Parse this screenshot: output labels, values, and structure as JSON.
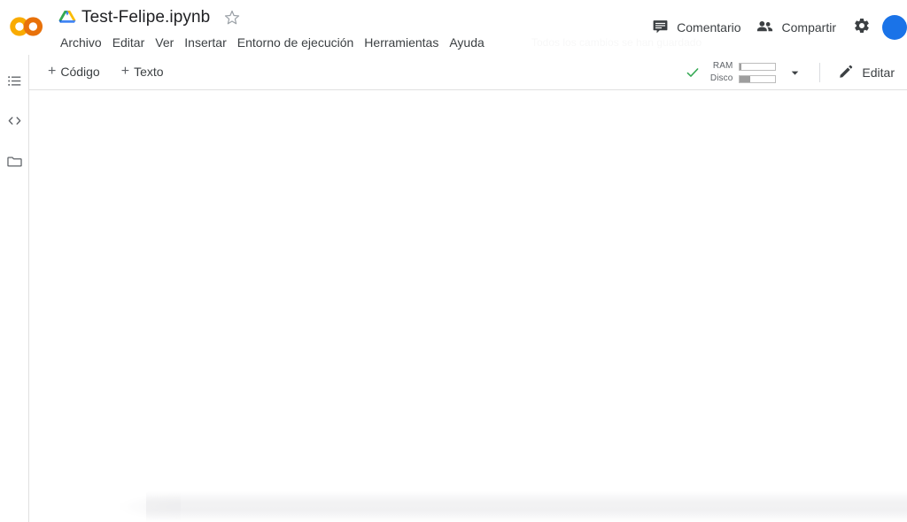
{
  "app": {
    "name": "Google Colab",
    "logo_icon": "colab-logo",
    "logo_colors": {
      "light": "#F9AB00",
      "dark": "#E8710A"
    }
  },
  "header": {
    "drive_icon": "google-drive-icon",
    "filename": "Test-Felipe.ipynb",
    "star_icon": "star-outline-icon",
    "save_status": "Todos los cambios se han guardado",
    "menu": [
      {
        "label": "Archivo",
        "name": "menu-archivo"
      },
      {
        "label": "Editar",
        "name": "menu-editar"
      },
      {
        "label": "Ver",
        "name": "menu-ver"
      },
      {
        "label": "Insertar",
        "name": "menu-insertar"
      },
      {
        "label": "Entorno de ejecución",
        "name": "menu-entorno-de-ejecucion"
      },
      {
        "label": "Herramientas",
        "name": "menu-herramientas"
      },
      {
        "label": "Ayuda",
        "name": "menu-ayuda"
      }
    ],
    "actions": {
      "comment_label": "Comentario",
      "comment_icon": "comment-icon",
      "share_label": "Compartir",
      "share_icon": "people-icon",
      "settings_icon": "gear-icon",
      "avatar": "user-avatar"
    }
  },
  "sidebar": {
    "items": [
      {
        "label": "Índice",
        "icon": "table-of-contents-icon",
        "name": "sidebar-item-toc"
      },
      {
        "label": "Fragmentos de código",
        "icon": "code-brackets-icon",
        "name": "sidebar-item-snippets"
      },
      {
        "label": "Archivos",
        "icon": "folder-icon",
        "name": "sidebar-item-files"
      }
    ]
  },
  "toolbar": {
    "add_code_label": "Código",
    "add_code_icon": "plus-icon",
    "add_text_label": "Texto",
    "add_text_icon": "plus-icon",
    "connection": {
      "status_icon": "green-check-icon",
      "status_color": "#34a853",
      "ram_label": "RAM",
      "ram_percent": 3,
      "disk_label": "Disco",
      "disk_percent": 30,
      "dropdown_icon": "chevron-down-icon"
    },
    "edit_label": "Editar",
    "edit_icon": "pencil-icon"
  },
  "notebook": {
    "cells": [],
    "placeholder_visible": true
  }
}
